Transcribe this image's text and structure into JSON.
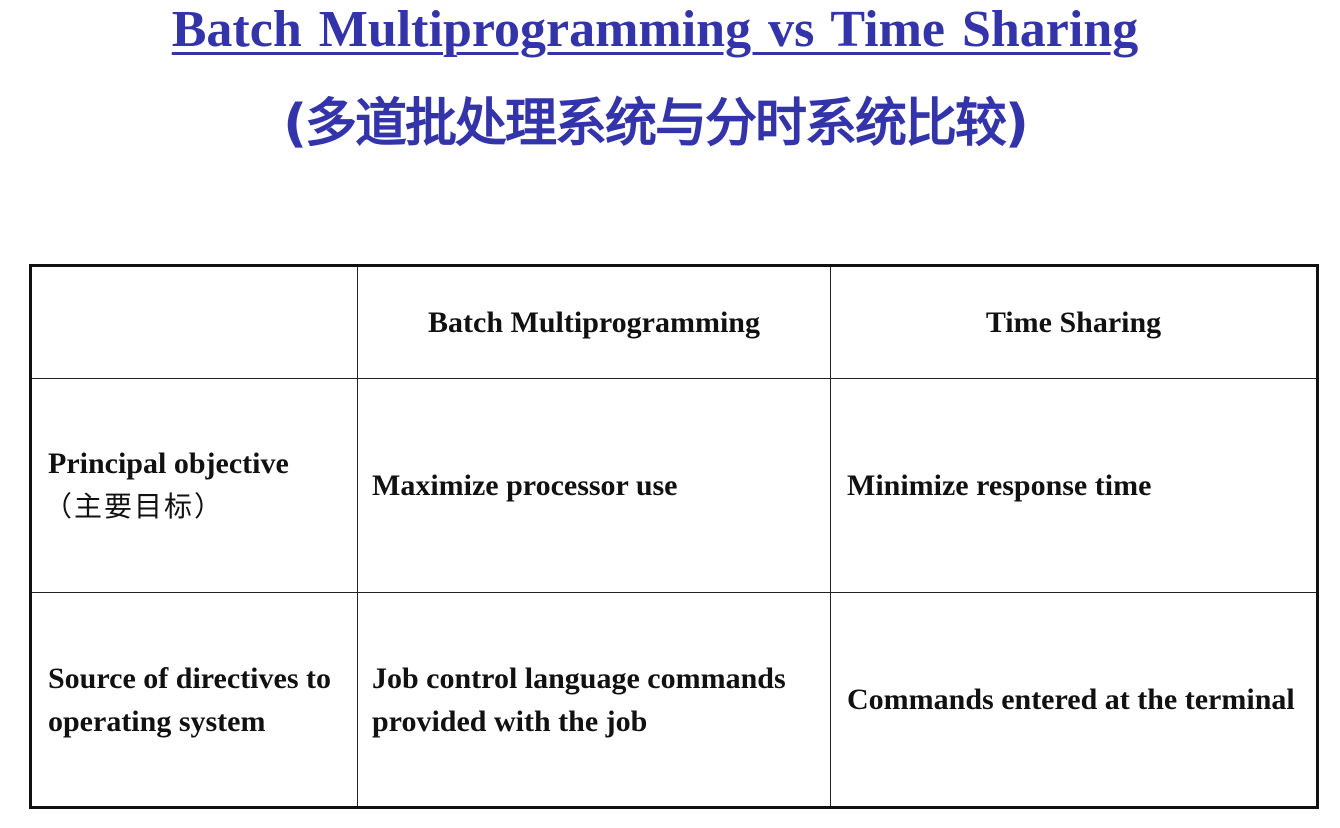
{
  "title": "Batch Multiprogramming vs Time Sharing",
  "subtitle": "(多道批处理系统与分时系统比较)",
  "colors": {
    "title": "#3333aa",
    "text": "#111111",
    "border": "#111111"
  },
  "table": {
    "headers": [
      "",
      "Batch Multiprogramming",
      "Time Sharing"
    ],
    "rows": [
      {
        "label": "Principal objective",
        "label_cn": "（主要目标）",
        "batch": "Maximize processor use",
        "timesharing": "Minimize response time"
      },
      {
        "label": "Source of directives to operating system",
        "label_cn": "",
        "batch": "Job control language commands provided with the job",
        "timesharing": "Commands entered at the terminal"
      }
    ]
  }
}
